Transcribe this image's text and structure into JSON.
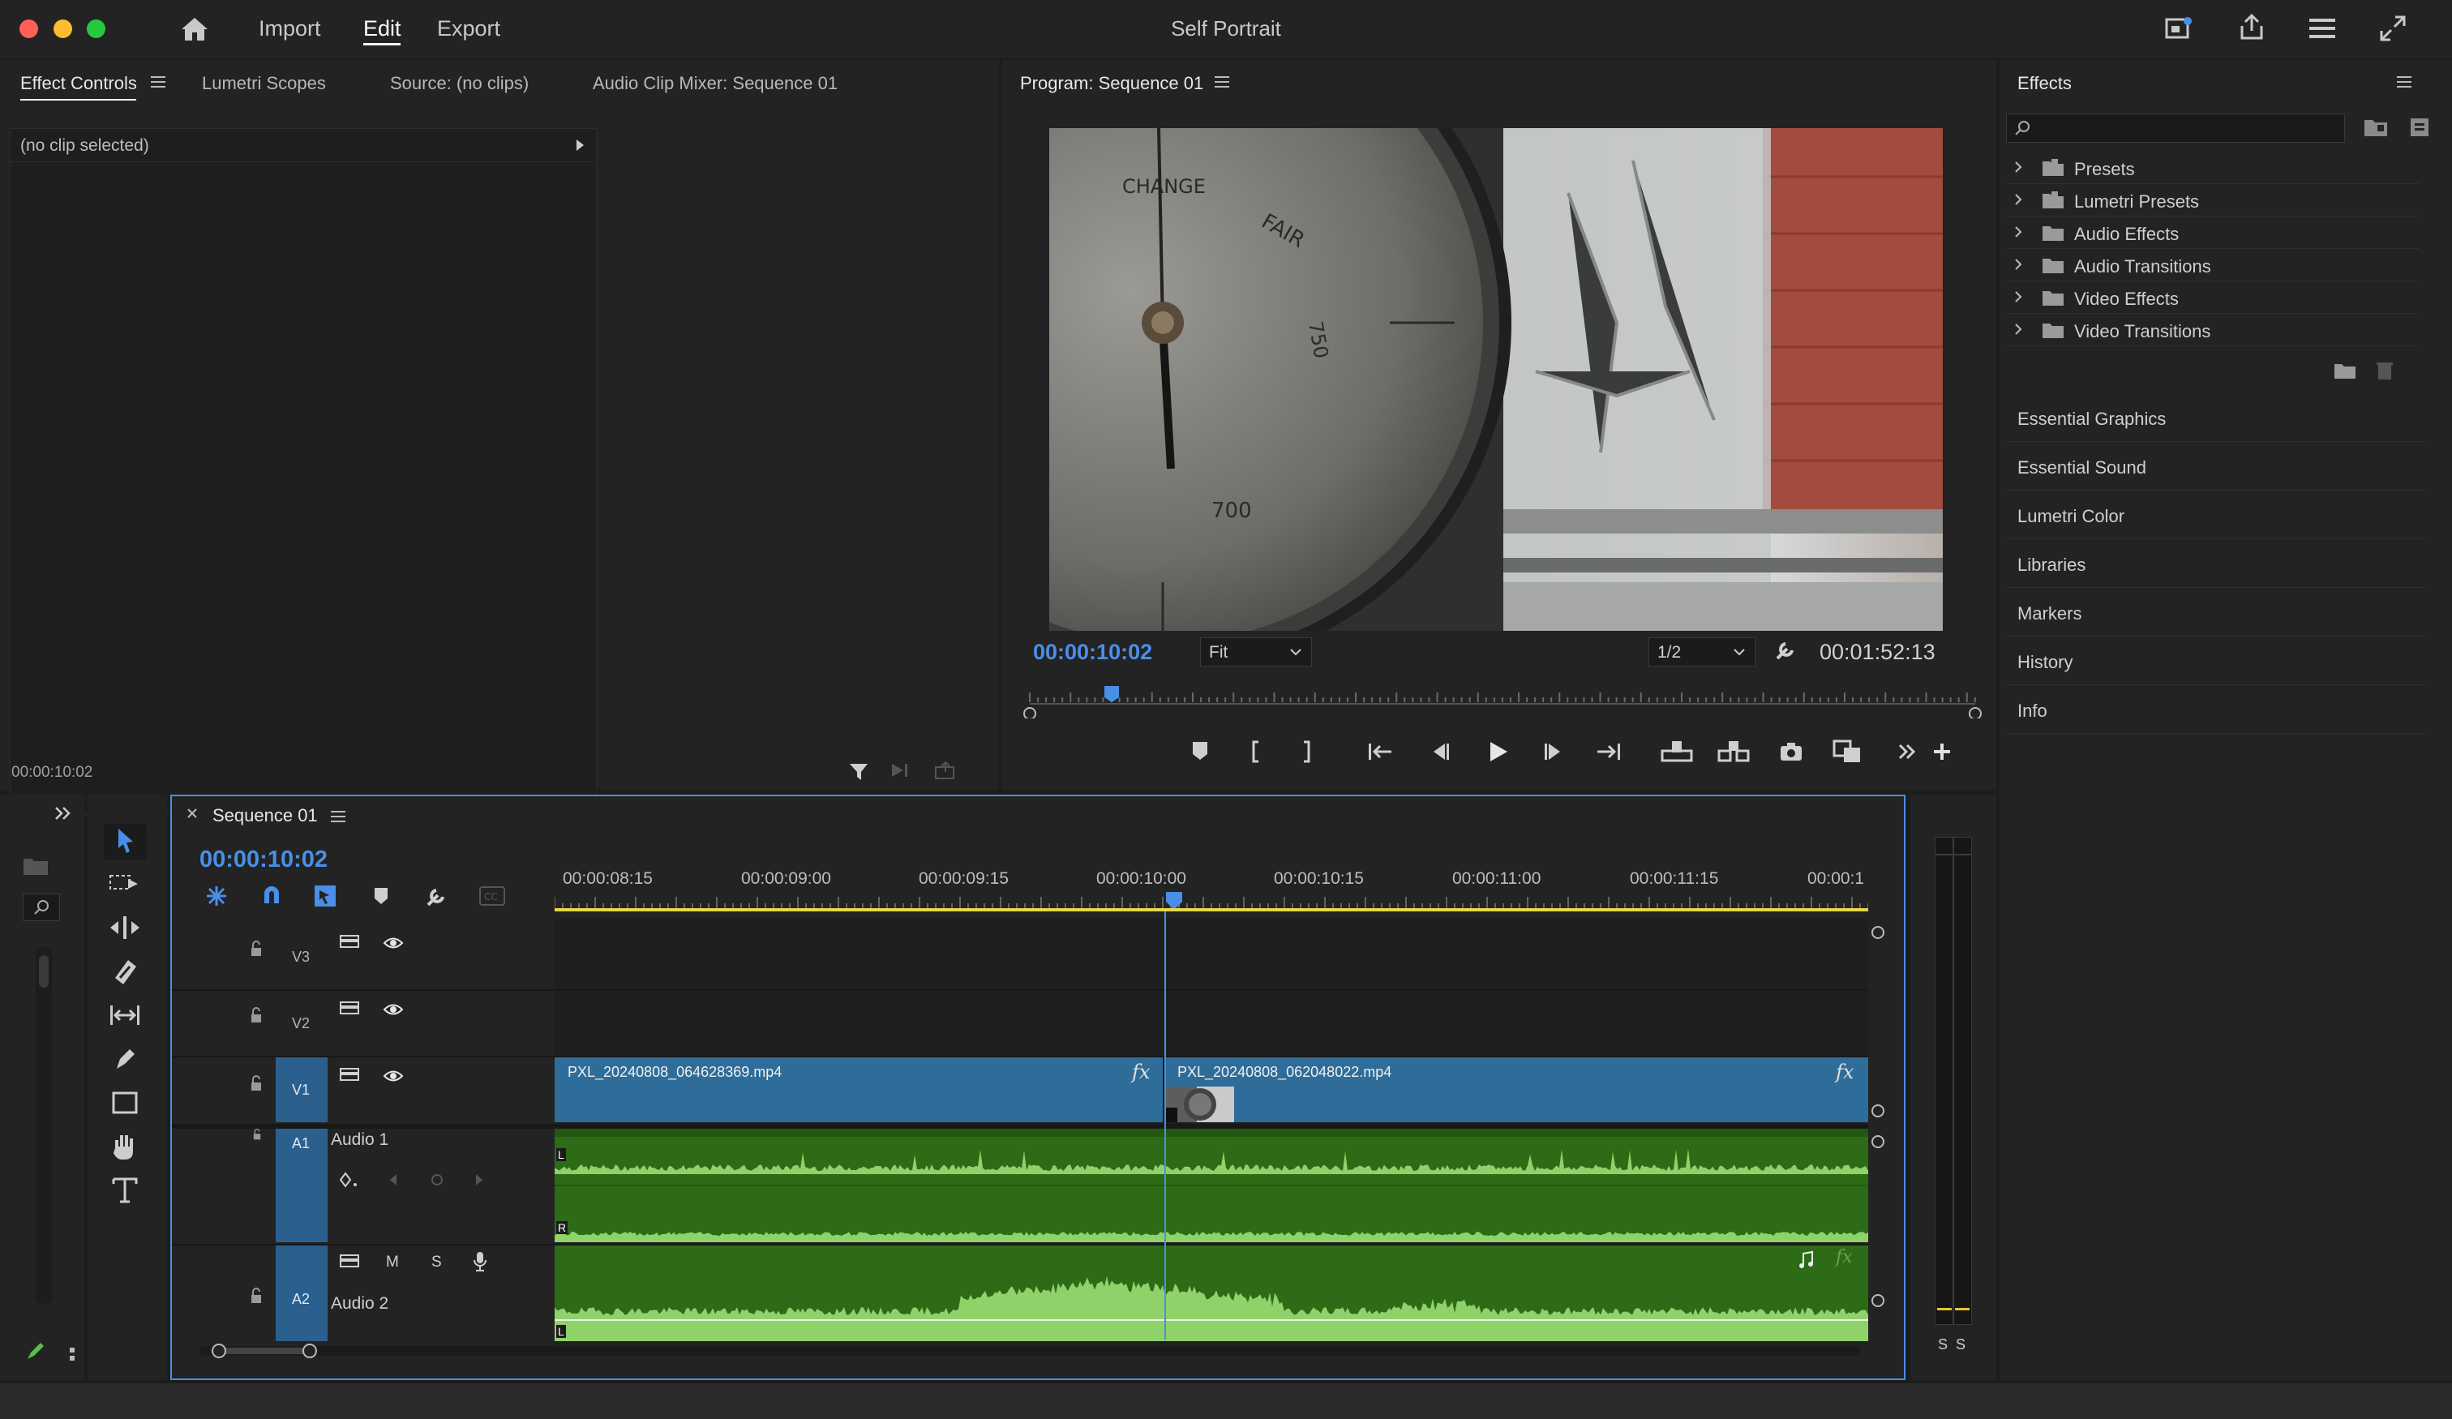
{
  "app": {
    "title": "Self Portrait",
    "nav": [
      "Import",
      "Edit",
      "Export"
    ],
    "active_nav": "Edit"
  },
  "colors": {
    "accent": "#4a8fe7",
    "clip_video": "#2e6d99",
    "clip_audio": "#2d6b16",
    "waveform": "#8fd26a",
    "panel_bg": "#232323",
    "app_bg": "#1d1d1d"
  },
  "source_panel": {
    "tabs": [
      "Effect Controls",
      "Lumetri Scopes",
      "Source: (no clips)",
      "Audio Clip Mixer: Sequence 01"
    ],
    "active_tab": "Effect Controls",
    "no_clip_text": "(no clip selected)",
    "timecode": "00:00:10:02"
  },
  "program_monitor": {
    "title": "Program: Sequence 01",
    "current_timecode": "00:00:10:02",
    "duration": "00:01:52:13",
    "fit_option": "Fit",
    "resolution": "1/2"
  },
  "effects_panel": {
    "title": "Effects",
    "search_placeholder": "",
    "folders": [
      "Presets",
      "Lumetri Presets",
      "Audio Effects",
      "Audio Transitions",
      "Video Effects",
      "Video Transitions"
    ],
    "sections": [
      "Essential Graphics",
      "Essential Sound",
      "Lumetri Color",
      "Libraries",
      "Markers",
      "History",
      "Info"
    ]
  },
  "timeline": {
    "sequence_name": "Sequence 01",
    "timecode": "00:00:10:02",
    "ruler_labels": [
      "00:00:08:15",
      "00:00:09:00",
      "00:00:09:15",
      "00:00:10:00",
      "00:00:10:15",
      "00:00:11:00",
      "00:00:11:15",
      "00:00:1"
    ],
    "tracks": {
      "v3": "V3",
      "v2": "V2",
      "v1": "V1",
      "a1": "A1",
      "a1_name": "Audio 1",
      "a2": "A2",
      "a2_name": "Audio 2",
      "mute": "M",
      "solo": "S"
    },
    "clips": {
      "clip1": "PXL_20240808_064628369.mp4",
      "clip2": "PXL_20240808_062048022.mp4",
      "fx": "fx"
    },
    "channel_left": "L",
    "channel_right": "R"
  },
  "meter": {
    "solo_labels": [
      "S",
      "S"
    ]
  }
}
